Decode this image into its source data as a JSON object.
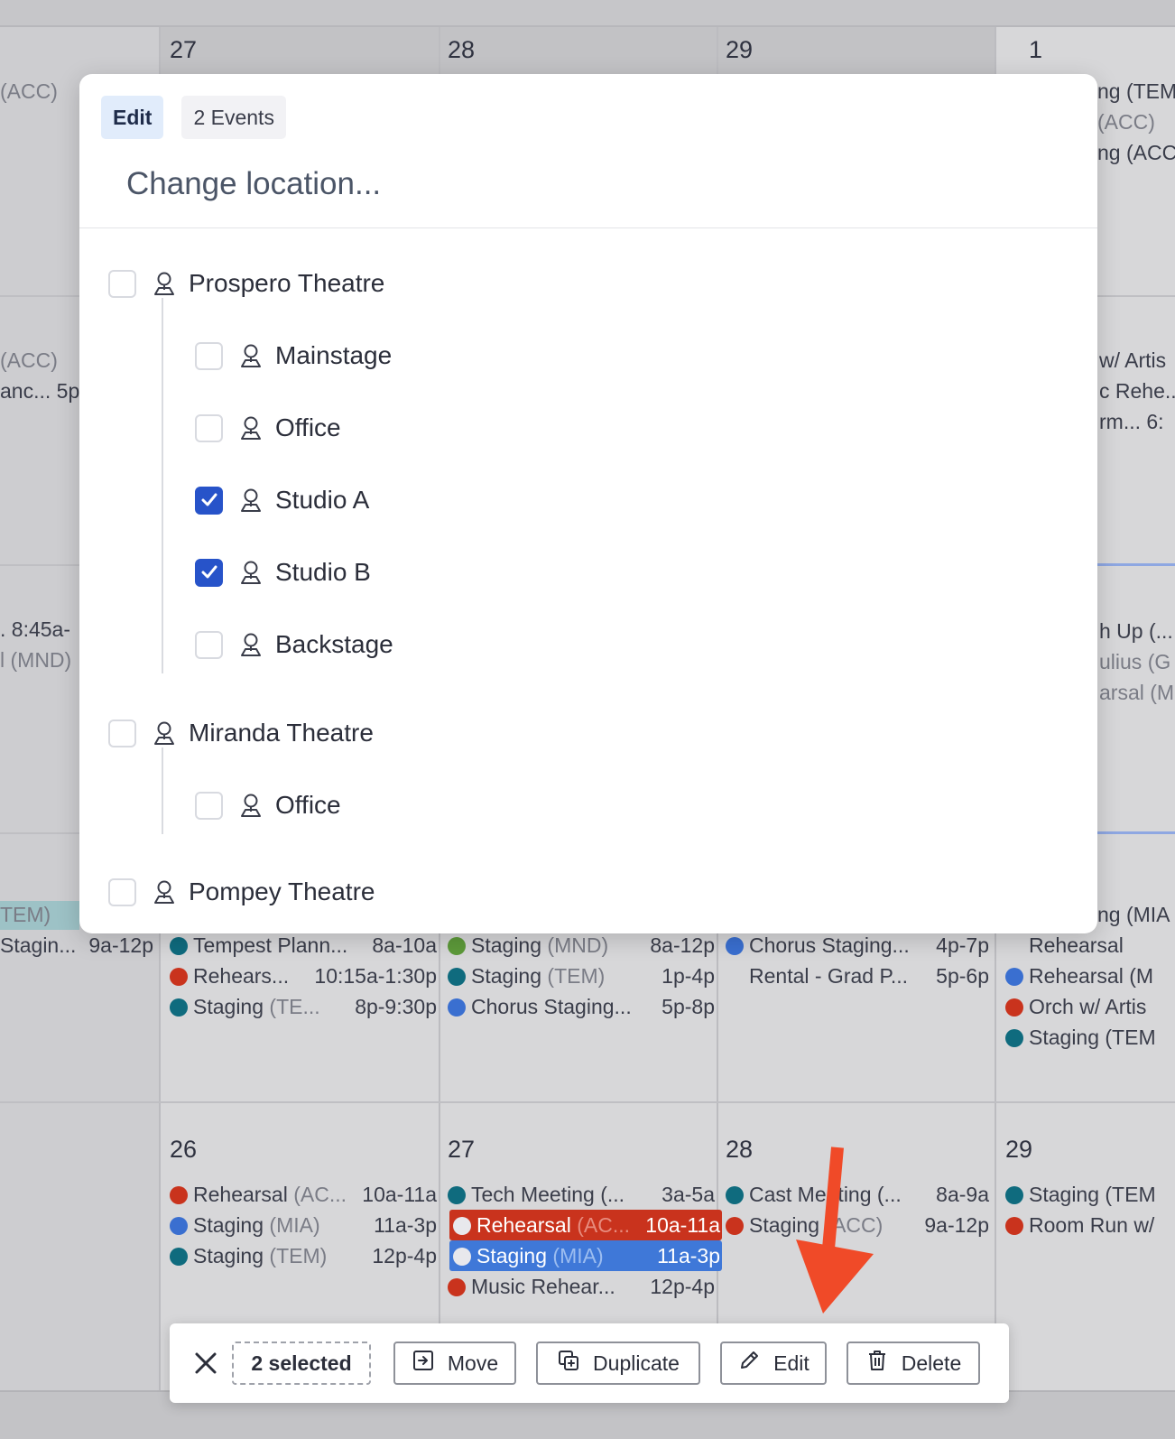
{
  "calendar": {
    "row1": {
      "days": [
        "27",
        "28",
        "29",
        "1"
      ],
      "left_ev": "(ACC)",
      "right_ev": [
        "ng (TEM",
        "(ACC)",
        "ng (ACC"
      ]
    },
    "row2": {
      "left_ev": [
        "(ACC)",
        "anc...",
        "5p"
      ],
      "right_ev": [
        "w/ Artis",
        "c Rehe...",
        "rm...",
        "6:"
      ]
    },
    "row3": {
      "left_ev": [
        ". 8:45a-",
        "l (MND)"
      ],
      "right_ev": [
        "h Up (...",
        "ulius (G",
        "arsal (M"
      ]
    },
    "row4": {
      "left_ev": [
        {
          "name": "TEM)"
        },
        {
          "name": "Stagin...",
          "time": "9a-12p"
        }
      ],
      "col1": [
        {
          "name": "Tempest Plann...",
          "time": "8a-10a",
          "color": "teal"
        },
        {
          "name": "Rehears...",
          "time": "10:15a-1:30p",
          "color": "red"
        },
        {
          "name": "Staging",
          "loc": "(TE...",
          "time": "8p-9:30p",
          "color": "teal"
        }
      ],
      "col2": [
        {
          "name": "Staging",
          "loc": "(MND)",
          "time": "8a-12p",
          "color": "green"
        },
        {
          "name": "Staging",
          "loc": "(TEM)",
          "time": "1p-4p",
          "color": "teal"
        },
        {
          "name": "Chorus Staging...",
          "time": "5p-8p",
          "color": "blue"
        }
      ],
      "col3": [
        {
          "name": "Chorus Staging...",
          "time": "4p-7p",
          "color": "blue"
        },
        {
          "name": "Rental - Grad P...",
          "time": "5p-6p",
          "color": "none"
        }
      ],
      "col4": [
        {
          "name": "ng (MIA",
          "color": "none"
        },
        {
          "name": "Rehearsal",
          "color": "none"
        },
        {
          "name": "Rehearsal (M",
          "color": "blue"
        },
        {
          "name": "Orch w/ Artis",
          "color": "red"
        },
        {
          "name": "Staging (TEM",
          "color": "teal"
        }
      ]
    },
    "row5": {
      "days": [
        "26",
        "27",
        "28",
        "29"
      ],
      "col1": [
        {
          "name": "Rehearsal",
          "loc": "(AC...",
          "time": "10a-11a",
          "color": "red"
        },
        {
          "name": "Staging",
          "loc": "(MIA)",
          "time": "11a-3p",
          "color": "blue"
        },
        {
          "name": "Staging",
          "loc": "(TEM)",
          "time": "12p-4p",
          "color": "teal"
        }
      ],
      "col2": [
        {
          "name": "Tech Meeting (...",
          "time": "3a-5a",
          "color": "teal"
        },
        {
          "name": "Rehearsal",
          "loc": "(AC...",
          "time": "10a-11a",
          "color": "white",
          "selected": "red"
        },
        {
          "name": "Staging",
          "loc": "(MIA)",
          "time": "11a-3p",
          "color": "white",
          "selected": "blue"
        },
        {
          "name": "Music Rehear...",
          "time": "12p-4p",
          "color": "red"
        }
      ],
      "col3": [
        {
          "name": "Cast Meeting (...",
          "time": "8a-9a",
          "color": "teal"
        },
        {
          "name": "Staging",
          "loc": "(ACC)",
          "time": "9a-12p",
          "color": "red"
        }
      ],
      "col4": [
        {
          "name": "Staging (TEM",
          "color": "teal"
        },
        {
          "name": "Room Run w/",
          "color": "red"
        }
      ]
    }
  },
  "popover": {
    "tabs": [
      "Edit",
      "2 Events"
    ],
    "search": {
      "placeholder": "Change location...",
      "value": ""
    },
    "locations": [
      {
        "label": "Prospero Theatre",
        "checked": false,
        "level": 0
      },
      {
        "label": "Mainstage",
        "checked": false,
        "level": 1
      },
      {
        "label": "Office",
        "checked": false,
        "level": 1
      },
      {
        "label": "Studio A",
        "checked": true,
        "level": 1
      },
      {
        "label": "Studio B",
        "checked": true,
        "level": 1
      },
      {
        "label": "Backstage",
        "checked": false,
        "level": 1
      },
      {
        "label": "Miranda Theatre",
        "checked": false,
        "level": 0
      },
      {
        "label": "Office",
        "checked": false,
        "level": 1
      },
      {
        "label": "Pompey Theatre",
        "checked": false,
        "level": 0
      }
    ]
  },
  "actionbar": {
    "count_label": "2 selected",
    "move_label": "Move",
    "duplicate_label": "Duplicate",
    "edit_label": "Edit",
    "delete_label": "Delete"
  },
  "colors": {
    "accent": "#2753c9",
    "teal": "#0f6b7e",
    "red": "#c9331d",
    "blue": "#3a6fd0",
    "green": "#5d9a3a",
    "arrow": "#f04a28"
  },
  "icons": [
    "close-icon",
    "move-icon",
    "duplicate-icon",
    "pencil-icon",
    "trash-icon",
    "location-pin-icon",
    "checkmark-icon"
  ]
}
